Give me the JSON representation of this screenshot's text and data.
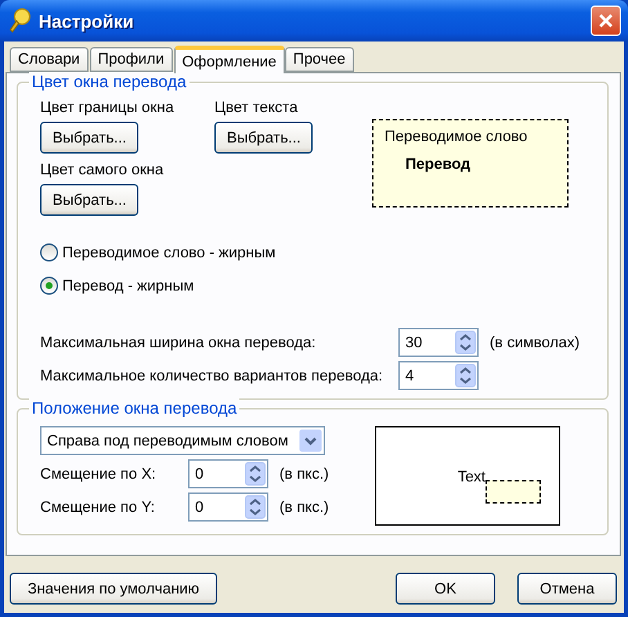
{
  "window": {
    "title": "Настройки"
  },
  "tabs": [
    {
      "label": "Словари",
      "selected": false
    },
    {
      "label": "Профили",
      "selected": false
    },
    {
      "label": "Оформление",
      "selected": true
    },
    {
      "label": "Прочее",
      "selected": false
    }
  ],
  "color_group": {
    "title": "Цвет окна перевода",
    "pickers": [
      {
        "label": "Цвет границы окна",
        "button": "Выбрать..."
      },
      {
        "label": "Цвет текста",
        "button": "Выбрать..."
      },
      {
        "label": "Цвет самого окна",
        "button": "Выбрать..."
      }
    ],
    "preview": {
      "word": "Переводимое слово",
      "translation": "Перевод"
    },
    "bold_options": [
      {
        "label": "Переводимое слово - жирным",
        "selected": false
      },
      {
        "label": "Перевод - жирным",
        "selected": true
      }
    ],
    "spinners": [
      {
        "label": "Максимальная ширина окна перевода:",
        "value": "30",
        "unit": "(в символах)"
      },
      {
        "label": "Максимальное количество вариантов перевода:",
        "value": "4"
      }
    ]
  },
  "position_group": {
    "title": "Положение окна перевода",
    "placement": "Справа под переводимым словом",
    "offsets": [
      {
        "label": "Смещение по X:",
        "value": "0",
        "unit": "(в пкс.)"
      },
      {
        "label": "Смещение по Y:",
        "value": "0",
        "unit": "(в пкс.)"
      }
    ],
    "preview": {
      "text": "Text"
    }
  },
  "buttons": [
    "Значения по умолчанию",
    "OK",
    "Отмена"
  ]
}
